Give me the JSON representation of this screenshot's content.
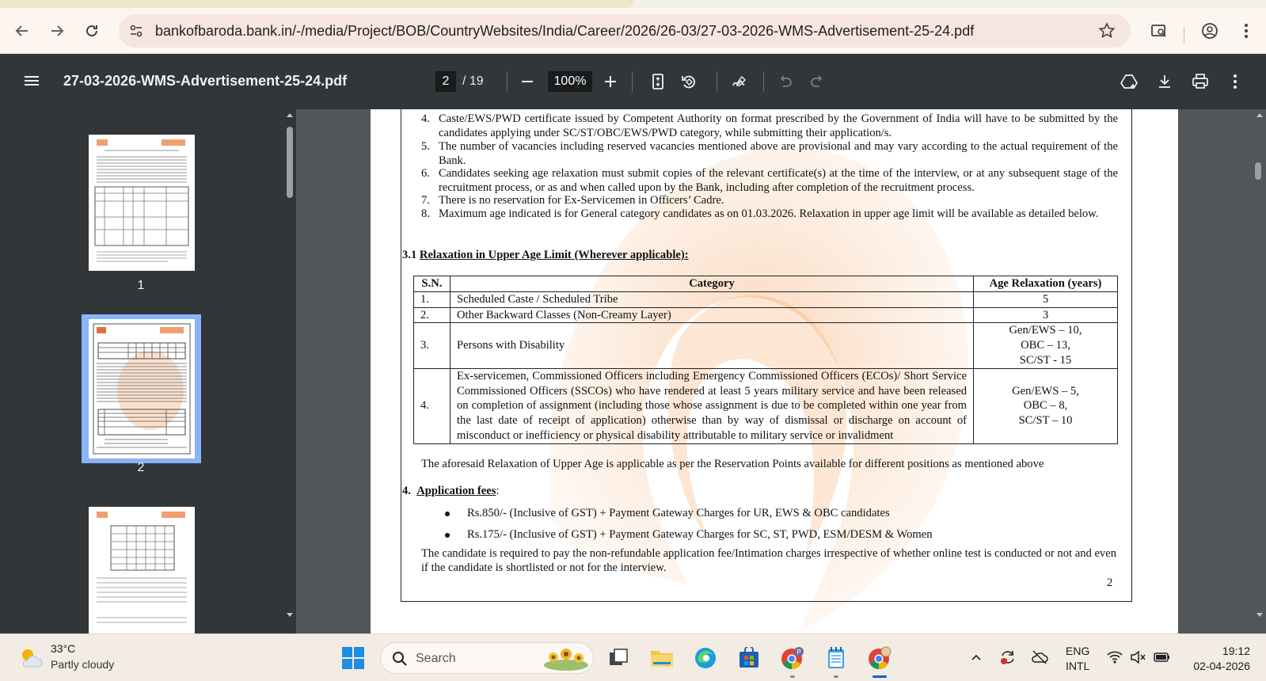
{
  "browser": {
    "url": "bankofbaroda.bank.in/-/media/Project/BOB/CountryWebsites/India/Career/2026/26-03/27-03-2026-WMS-Advertisement-25-24.pdf",
    "icons": [
      "back-icon",
      "forward-icon",
      "reload-icon",
      "site-info-icon",
      "bookmark-star-icon",
      "screen-capture-icon",
      "profile-icon",
      "more-menu-icon"
    ]
  },
  "pdf_toolbar": {
    "title": "27-03-2026-WMS-Advertisement-25-24.pdf",
    "current_page": "2",
    "page_total": "/ 19",
    "zoom": "100%"
  },
  "sidebar": {
    "thumbnails": [
      {
        "label": "1"
      },
      {
        "label": "2"
      },
      {
        "label": "3"
      }
    ]
  },
  "document": {
    "notes": [
      {
        "num": "4.",
        "text": "Caste/EWS/PWD certificate issued by Competent Authority on format prescribed by the Government of India will have to be submitted by the candidates applying under SC/ST/OBC/EWS/PWD category, while submitting their application/s."
      },
      {
        "num": "5.",
        "text": "The number of vacancies including reserved vacancies mentioned above are provisional and may vary according to the actual requirement of the Bank."
      },
      {
        "num": "6.",
        "text": "Candidates seeking age relaxation must submit copies of the relevant certificate(s) at the time of the interview, or at any subsequent stage of the recruitment process, or as and when called upon by the Bank, including after completion of the recruitment process."
      },
      {
        "num": "7.",
        "text": "There is no reservation for Ex-Servicemen in Officers’ Cadre."
      },
      {
        "num": "8.",
        "text": "Maximum age indicated is for General category candidates as on 01.03.2026. Relaxation in upper age limit will be available as detailed below."
      }
    ],
    "section_31": {
      "num": "3.1",
      "title": "Relaxation in Upper Age Limit (Wherever applicable):"
    },
    "table": {
      "headers": [
        "S.N.",
        "Category",
        "Age Relaxation (years)"
      ],
      "rows": [
        {
          "sn": "1.",
          "category": "Scheduled Caste / Scheduled Tribe",
          "age": [
            "5"
          ]
        },
        {
          "sn": "2.",
          "category": "Other Backward Classes (Non-Creamy Layer)",
          "age": [
            "3"
          ]
        },
        {
          "sn": "3.",
          "category": "Persons with Disability",
          "age": [
            "Gen/EWS – 10,",
            "OBC – 13,",
            "SC/ST - 15"
          ]
        },
        {
          "sn": "4.",
          "category": "Ex-servicemen, Commissioned Officers including Emergency Commissioned Officers (ECOs)/ Short Service Commissioned Officers (SSCOs) who have rendered at least 5 years military service and have been released on completion of assignment (including those whose assignment is due to be completed within one year from the last date of receipt of application) otherwise than by way of dismissal or discharge on account of misconduct or inefficiency or physical disability attributable to military service or invalidment",
          "age": [
            "Gen/EWS – 5,",
            "OBC – 8,",
            "SC/ST – 10"
          ]
        }
      ]
    },
    "table_note": "The aforesaid Relaxation of Upper Age is applicable as per the Reservation Points available for different positions as mentioned above",
    "section_4": {
      "num": "4.",
      "title": "Application fees"
    },
    "fees": [
      "Rs.850/- (Inclusive of GST) + Payment Gateway Charges for UR, EWS & OBC candidates",
      "Rs.175/- (Inclusive of GST) + Payment Gateway Charges for SC, ST, PWD, ESM/DESM & Women"
    ],
    "fee_paragraph": "The candidate is required to pay the non-refundable application fee/Intimation charges irrespective of whether online test is conducted or not and even if the candidate is shortlisted or not for the interview.",
    "page_number": "2"
  },
  "taskbar": {
    "weather_temp": "33°C",
    "weather_desc": "Partly cloudy",
    "search_placeholder": "Search",
    "lang_line1": "ENG",
    "lang_line2": "INTL",
    "time": "19:12",
    "date": "02-04-2026"
  }
}
